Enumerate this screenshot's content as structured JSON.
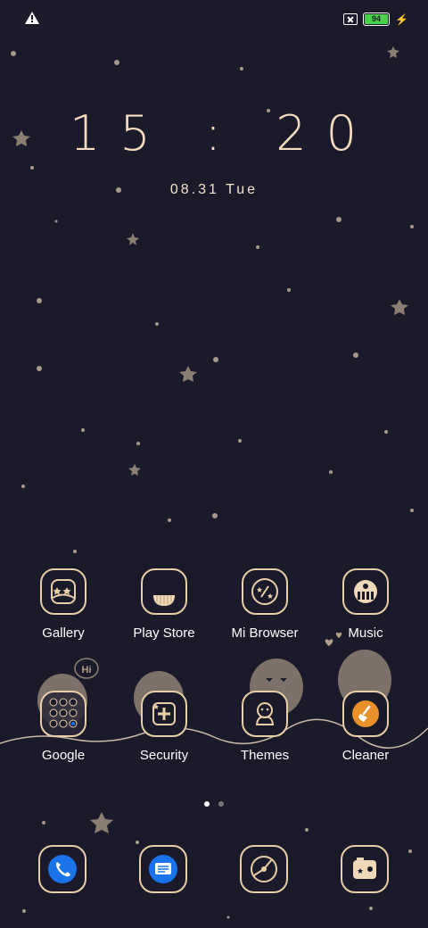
{
  "status_bar": {
    "battery_level": "94"
  },
  "clock": {
    "time": "15 : 20",
    "date": "08.31  Tue"
  },
  "apps_row1": [
    {
      "label": "Gallery",
      "icon": "gallery-icon"
    },
    {
      "label": "Play Store",
      "icon": "play-store-icon"
    },
    {
      "label": "Mi Browser",
      "icon": "mi-browser-icon"
    },
    {
      "label": "Music",
      "icon": "music-icon"
    }
  ],
  "apps_row2": [
    {
      "label": "Google",
      "icon": "google-folder-icon"
    },
    {
      "label": "Security",
      "icon": "security-icon"
    },
    {
      "label": "Themes",
      "icon": "themes-icon"
    },
    {
      "label": "Cleaner",
      "icon": "cleaner-icon"
    }
  ],
  "decoration": {
    "speech_bubble": "Hi"
  },
  "dock": [
    {
      "icon": "phone-icon",
      "color": "#1a73e8"
    },
    {
      "icon": "messages-icon",
      "color": "#1a73e8"
    },
    {
      "icon": "camera-icon"
    },
    {
      "icon": "photos-icon"
    }
  ],
  "page_indicator": {
    "pages": 2,
    "current": 1
  },
  "colors": {
    "background": "#1b1a2b",
    "accent": "#e9cfa8",
    "cleaner": "#e8912a"
  }
}
